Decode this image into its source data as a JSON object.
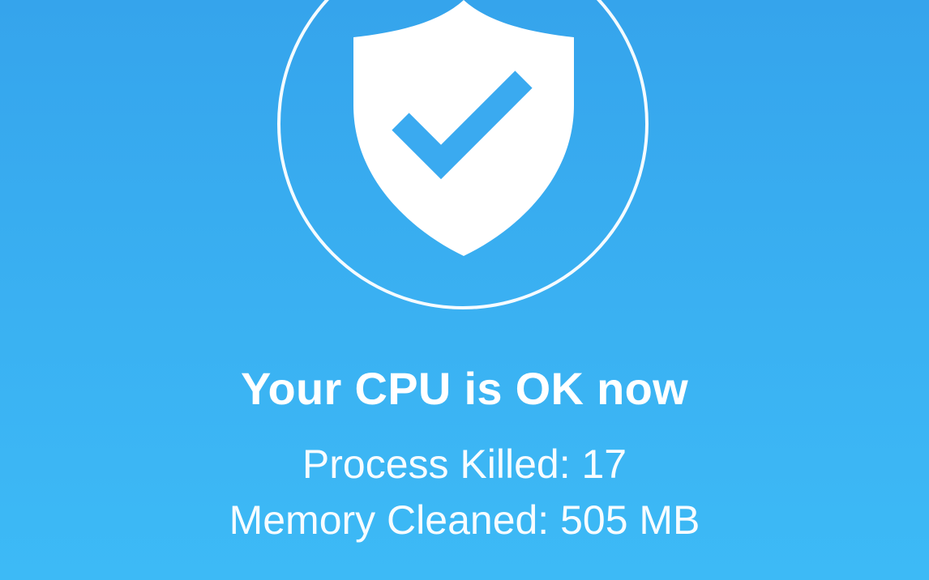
{
  "status_icon": "shield-check-icon",
  "colors": {
    "background_top": "#35a4ec",
    "background_bottom": "#3dbaf6",
    "foreground": "#ffffff"
  },
  "result": {
    "title": "Your CPU is OK now",
    "process_killed": "Process Killed: 17",
    "memory_cleaned": "Memory Cleaned: 505 MB"
  }
}
